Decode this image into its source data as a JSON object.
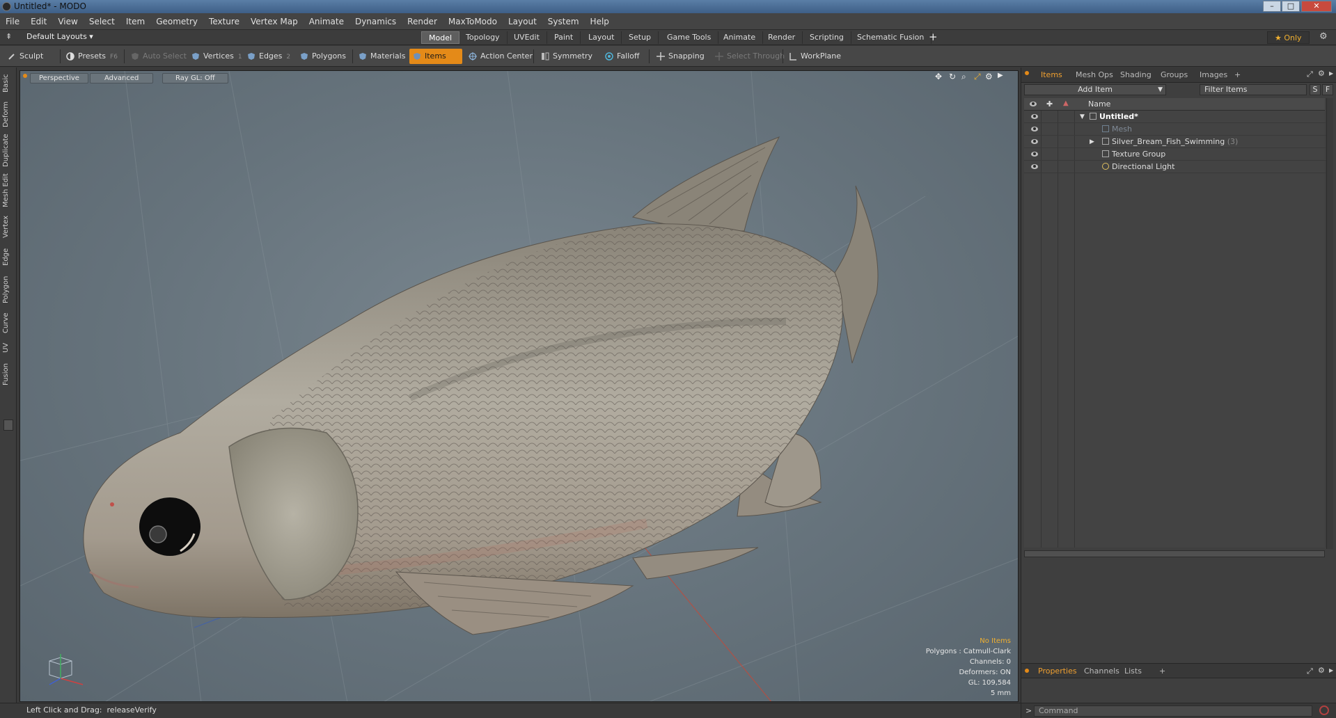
{
  "window": {
    "title": "Untitled* - MODO",
    "minimize": "–",
    "maximize": "□",
    "close": "✕"
  },
  "menu": [
    "File",
    "Edit",
    "View",
    "Select",
    "Item",
    "Geometry",
    "Texture",
    "Vertex Map",
    "Animate",
    "Dynamics",
    "Render",
    "MaxToModo",
    "Layout",
    "System",
    "Help"
  ],
  "layouts": {
    "preset": "Default Layouts ▾",
    "tabs": [
      "Model",
      "Topology",
      "UVEdit",
      "Paint",
      "Layout",
      "Setup",
      "Game Tools",
      "Animate",
      "Render",
      "Scripting",
      "Schematic Fusion"
    ],
    "active": "Model",
    "add": "+",
    "only": "★ Only"
  },
  "toolbar": {
    "sculpt": "Sculpt",
    "presets": "Presets",
    "presets_key": "F6",
    "auto_select": "Auto Select",
    "vertices": "Vertices",
    "vertices_key": "1",
    "edges": "Edges",
    "edges_key": "2",
    "polygons": "Polygons",
    "materials": "Materials",
    "items": "Items",
    "action_center": "Action Center",
    "symmetry": "Symmetry",
    "falloff": "Falloff",
    "snapping": "Snapping",
    "select_through": "Select Through",
    "workplane": "WorkPlane"
  },
  "left_tabs": [
    "Basic",
    "Deform",
    "Duplicate",
    "Mesh Edit",
    "Vertex",
    "Edge",
    "Polygon",
    "Curve",
    "UV",
    "Fusion"
  ],
  "viewport": {
    "view": "Perspective",
    "advanced": "Advanced",
    "raygl": "Ray GL: Off",
    "info": {
      "no_items": "No Items",
      "polygons": "Polygons : Catmull-Clark",
      "channels": "Channels: 0",
      "deformers": "Deformers: ON",
      "gl": "GL: 109,584",
      "scale": "5 mm"
    }
  },
  "status": {
    "hint": "Left Click and Drag:",
    "action": "releaseVerify"
  },
  "items_panel": {
    "tabs": [
      "Items",
      "Mesh Ops",
      "Shading",
      "Groups",
      "Images"
    ],
    "add_tab": "+",
    "add_item": "Add Item",
    "filter_placeholder": "Filter Items",
    "filter_s": "S",
    "filter_f": "F",
    "column_name": "Name",
    "tree": [
      {
        "label": "Untitled*",
        "expander": "▼",
        "level": 0
      },
      {
        "label": "Mesh",
        "expander": "",
        "level": 1
      },
      {
        "label": "Silver_Bream_Fish_Swimming",
        "count": "(3)",
        "expander": "▶",
        "level": 1
      },
      {
        "label": "Texture Group",
        "expander": "",
        "level": 1
      },
      {
        "label": "Directional Light",
        "expander": "",
        "level": 1
      }
    ]
  },
  "properties_panel": {
    "tabs": [
      "Properties",
      "Channels",
      "Lists"
    ],
    "add_tab": "+",
    "command_prompt": ">",
    "command_placeholder": "Command"
  },
  "colors": {
    "accent": "#e48a18",
    "active_tab_text": "#f0a030",
    "viewport_bg": "#6b7880"
  }
}
